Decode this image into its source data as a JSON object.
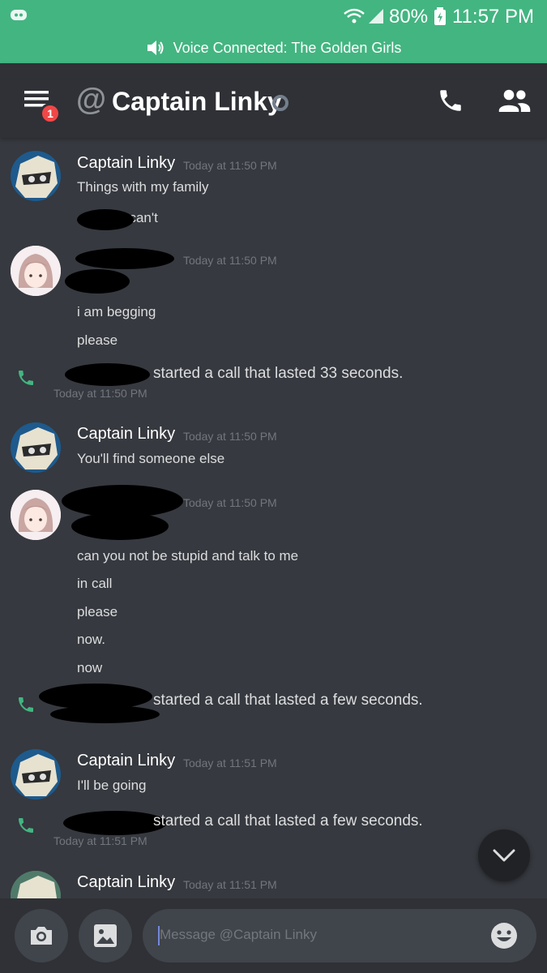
{
  "status_bar": {
    "battery": "80%",
    "time": "11:57 PM"
  },
  "voice_bar": {
    "text": "Voice Connected: The Golden Girls"
  },
  "header": {
    "symbol": "@",
    "title": "Captain Linky",
    "badge": "1"
  },
  "messages": [
    {
      "type": "message",
      "author": "Captain Linky",
      "timestamp": "Today at 11:50 PM",
      "lines": [
        "Things with my family",
        "I can't"
      ]
    },
    {
      "type": "message",
      "author": "",
      "timestamp": "Today at 11:50 PM",
      "lines": [
        "i am begging",
        "please"
      ]
    },
    {
      "type": "call",
      "text": "started a call that lasted 33 seconds.",
      "timestamp": "Today at 11:50 PM"
    },
    {
      "type": "message",
      "author": "Captain Linky",
      "timestamp": "Today at 11:50 PM",
      "lines": [
        "You'll find someone else"
      ]
    },
    {
      "type": "message",
      "author": "",
      "timestamp": "Today at 11:50 PM",
      "lines": [
        "can you not be stupid and talk to me",
        "in call",
        "please",
        "now.",
        "now"
      ]
    },
    {
      "type": "call",
      "text": "started a call that lasted a few seconds.",
      "timestamp": ""
    },
    {
      "type": "message",
      "author": "Captain Linky",
      "timestamp": "Today at 11:51 PM",
      "lines": [
        "I'll be going"
      ]
    },
    {
      "type": "call",
      "text": "started a call that lasted a few seconds.",
      "timestamp": "Today at 11:51 PM"
    },
    {
      "type": "message",
      "author": "Captain Linky",
      "timestamp": "Today at 11:51 PM",
      "lines": []
    }
  ],
  "input": {
    "placeholder": "Message @Captain Linky"
  },
  "icons": [
    "discord-logo",
    "wifi",
    "signal",
    "battery",
    "speaker",
    "hamburger",
    "at-sign",
    "status-offline",
    "phone",
    "people",
    "phone-call",
    "chevron-down",
    "camera",
    "image",
    "emoji"
  ],
  "colors": {
    "accent": "#43b581",
    "background": "#36393f",
    "header": "#2f3136",
    "badge": "#f04747"
  }
}
